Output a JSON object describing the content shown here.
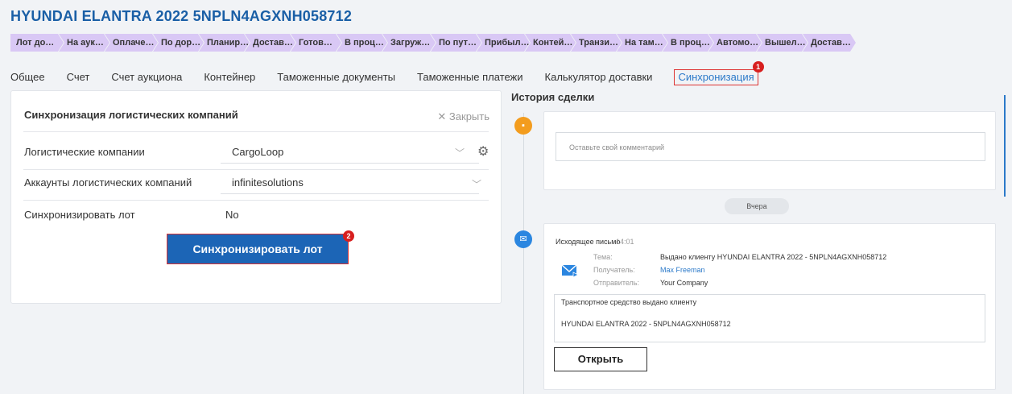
{
  "title": "HYUNDAI ELANTRA 2022 5NPLN4AGXNH058712",
  "stages": [
    "Лот до…",
    "На аук…",
    "Оплаче…",
    "По дор…",
    "Планир…",
    "Достав…",
    "Готов…",
    "В проц…",
    "Загруж…",
    "По пут…",
    "Прибыл…",
    "Контей…",
    "Транзи…",
    "На там…",
    "В проц…",
    "Автомо…",
    "Вышел…",
    "Достав…"
  ],
  "tabs": [
    "Общее",
    "Счет",
    "Счет аукциона",
    "Контейнер",
    "Таможенные документы",
    "Таможенные платежи",
    "Калькулятор доставки",
    "Синхронизация"
  ],
  "badges": {
    "tab": "1",
    "button": "2"
  },
  "panel": {
    "title": "Синхронизация логистических компаний",
    "close_label": "Закрыть",
    "rows": [
      {
        "label": "Логистические компании",
        "value": "CargoLoop"
      },
      {
        "label": "Аккаунты логистических компаний",
        "value": "infinitesolutions"
      },
      {
        "label": "Синхронизировать лот",
        "value": "No"
      }
    ],
    "button_label": "Синхронизировать лот"
  },
  "history": {
    "title": "История сделки",
    "comment_placeholder": "Оставьте свой комментарий",
    "date_label": "Вчера",
    "email": {
      "type": "Исходящее письмо",
      "time": "14:01",
      "subject_label": "Тема:",
      "subject": "Выдано клиенту HYUNDAI ELANTRA 2022 - 5NPLN4AGXNH058712",
      "recipient_label": "Получатель:",
      "recipient": "Max Freeman",
      "sender_label": "Отправитель:",
      "sender": "Your Company",
      "body_line1": "Транспортное средство выдано клиенту",
      "body_line2": "HYUNDAI ELANTRA 2022 - 5NPLN4AGXNH058712",
      "open_label": "Открыть"
    }
  },
  "colors": {
    "accent": "#1c65b6",
    "stage": "#d9c8f5",
    "highlight": "#dd3333",
    "comment_icon": "#f39c1e",
    "email_icon": "#2b86e0"
  }
}
